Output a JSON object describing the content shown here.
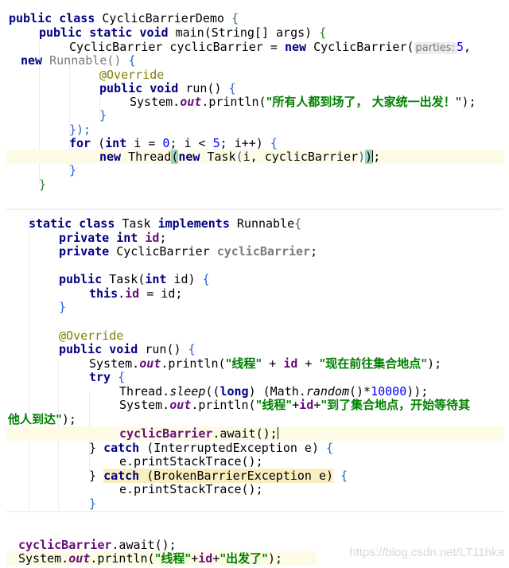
{
  "editor": {
    "theme": "IntelliJ light",
    "colors": {
      "keyword": "#000080",
      "string": "#008000",
      "field": "#660e7a",
      "number": "#0000ff",
      "annotation": "#808000",
      "current_line": "#fdfbe6",
      "brace_match": "#99d6c0",
      "warning_highlight": "#f8eec0"
    }
  },
  "snippet1": {
    "l1": {
      "a": "public class ",
      "b": "CyclicBarrierDemo ",
      "c": "{"
    },
    "l2": {
      "a": "public static void ",
      "b": "main(String[] args) ",
      "c": "{"
    },
    "l3": {
      "a": "CyclicBarrier cyclicBarrier = ",
      "b": "new ",
      "c": "CyclicBarrier(",
      "hint": "parties:",
      "num": "5",
      "d": ","
    },
    "l4": {
      "a": "new ",
      "b": "Runnable() ",
      "c": "{"
    },
    "l5": {
      "a": "@Override"
    },
    "l6": {
      "a": "public void ",
      "b": "run() ",
      "c": "{"
    },
    "l7": {
      "a": "System.",
      "b": "out",
      "c": ".println(",
      "str": "\"所有人都到场了， 大家统一出发！\"",
      "d": ");"
    },
    "l8": {
      "a": "}"
    },
    "l9": {
      "a": "});"
    },
    "l10": {
      "a": "for ",
      "b": "(",
      "c": "int ",
      "d": "i = ",
      "num0": "0",
      "e": "; i < ",
      "num5": "5",
      "f": "; i++) ",
      "g": "{"
    },
    "l11": {
      "a": "new ",
      "b": "Thread",
      "c": "(",
      "d": "new ",
      "e": "Task",
      "f": "(",
      "g": "i, cyclicBarrier",
      "h": ")",
      "i": ")",
      "j": ";"
    },
    "l12": {
      "a": "}"
    },
    "l13": {
      "a": "}"
    }
  },
  "snippet2": {
    "l1": {
      "a": "static class ",
      "b": "Task ",
      "c": "implements ",
      "d": "Runnable",
      "e": "{"
    },
    "l2": {
      "a": "private int ",
      "b": "id",
      "c": ";"
    },
    "l3": {
      "a": "private ",
      "b": "CyclicBarrier ",
      "c": "cyclicBarrier",
      "d": ";"
    },
    "l4": {
      "a": "public ",
      "b": "Task(",
      "c": "int ",
      "d": "id) ",
      "e": "{"
    },
    "l5": {
      "a": "this",
      "b": ".",
      "c": "id",
      "d": " = id;"
    },
    "l6": {
      "a": "}"
    },
    "l7": {
      "a": "@Override"
    },
    "l8": {
      "a": "public void ",
      "b": "run() ",
      "c": "{"
    },
    "l9": {
      "a": "System.",
      "b": "out",
      "c": ".println(",
      "s1": "\"线程\"",
      "d": " + ",
      "id": "id",
      "e": " + ",
      "s2": "\"现在前往集合地点\"",
      "f": ");"
    },
    "l10": {
      "a": "try ",
      "b": "{"
    },
    "l11": {
      "a": "Thread.",
      "b": "sleep",
      "c": "((",
      "d": "long",
      "e": ") (Math.",
      "f": "random",
      "g": "()*",
      "num": "10000",
      "h": "));"
    },
    "l12": {
      "a": "System.",
      "b": "out",
      "c": ".println(",
      "s1": "\"线程\"",
      "d": "+",
      "id": "id",
      "e": "+",
      "s2": "\"到了集合地点，开始等待其"
    },
    "l13": {
      "s": "他人到达\"",
      "a": ");"
    },
    "l14": {
      "a": "cyclicBarrier",
      "b": ".await();"
    },
    "l15": {
      "a": "} ",
      "b": "catch ",
      "c": "(InterruptedException e) ",
      "d": "{"
    },
    "l16": {
      "a": "e.printStackTrace();"
    },
    "l17": {
      "a": "} ",
      "b": "catch ",
      "c": "(BrokenBarrierException e)",
      "d": " {"
    },
    "l18": {
      "a": "e.printStackTrace();"
    },
    "l19": {
      "a": "}"
    }
  },
  "snippet3": {
    "l1": {
      "a": "cyclicBarrier",
      "b": ".await();"
    },
    "l2": {
      "a": "System.",
      "b": "out",
      "c": ".println(",
      "s1": "\"线程\"",
      "d": "+",
      "id": "id",
      "e": "+",
      "s2": "\"出发了\"",
      "f": ");"
    }
  },
  "watermark": "https://blog.csdn.net/LT11hka"
}
